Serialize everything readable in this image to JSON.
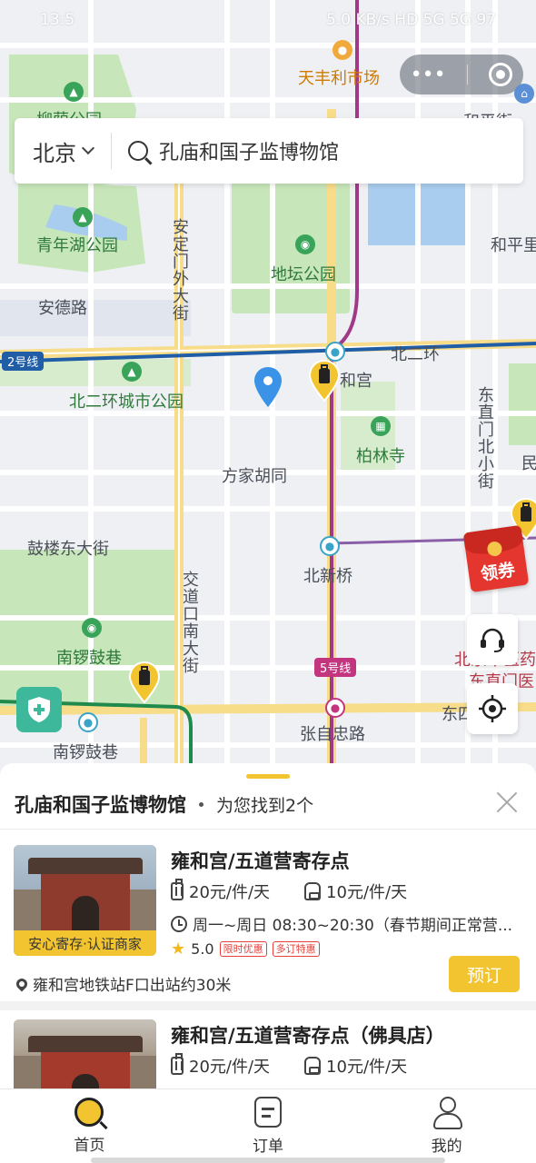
{
  "status_bar": {
    "time": "13:5",
    "right": "5.0 KB/s  HD  5G  5G  97"
  },
  "map": {
    "labels": {
      "tianfengli": "天丰利市场",
      "liuyin": "柳荫公园",
      "hepingjie": "和平街",
      "qingnianhu": "青年湖公园",
      "heping_li": "和平里",
      "ditan": "地坛公园",
      "andelu": "安德路",
      "andingmen": "安定门外大街",
      "beierhuan": "北二环",
      "line2": "2号线",
      "beierhuan_park": "北二环城市公园",
      "yonghegong": "和宫",
      "bailinsi": "柏林寺",
      "dongzhimen": "东直门北小街",
      "fangjia": "方家胡同",
      "min": "民",
      "gulou": "鼓楼东大街",
      "beixinqiao": "北新桥",
      "jiaodaokou": "交道口南大街",
      "nanluoguxiang_park": "南锣鼓巷",
      "line5": "5号线",
      "beijing_hosp": "北京中医药",
      "dongzhimen_hosp": "东直门医",
      "dongsi": "东四",
      "zhangzizhong": "张自忠路",
      "nanluoguxiang_station": "南锣鼓巷"
    },
    "coupon_label": "领券"
  },
  "search": {
    "city": "北京",
    "query": "孔庙和国子监博物馆"
  },
  "sheet": {
    "title": "孔庙和国子监博物馆",
    "found": "为您找到2个",
    "cards": [
      {
        "name": "雍和宫/五道营寄存点",
        "price_bag": "20元/件/天",
        "price_pack": "10元/件/天",
        "hours": "周一~周日 08:30~20:30（春节期间正常营...",
        "rating": "5.0",
        "tags": [
          "限时优惠",
          "多订特惠"
        ],
        "badge": "安心寄存·认证商家",
        "location": "雍和宫地铁站F口出站约30米",
        "book": "预订"
      },
      {
        "name": "雍和宫/五道营寄存点（佛具店）",
        "price_bag": "20元/件/天",
        "price_pack": "10元/件/天"
      }
    ]
  },
  "nav": {
    "home": "首页",
    "orders": "订单",
    "mine": "我的"
  },
  "colors": {
    "accent": "#f2c530",
    "map_bg": "#eef0f3",
    "park": "#c7e6b9"
  }
}
